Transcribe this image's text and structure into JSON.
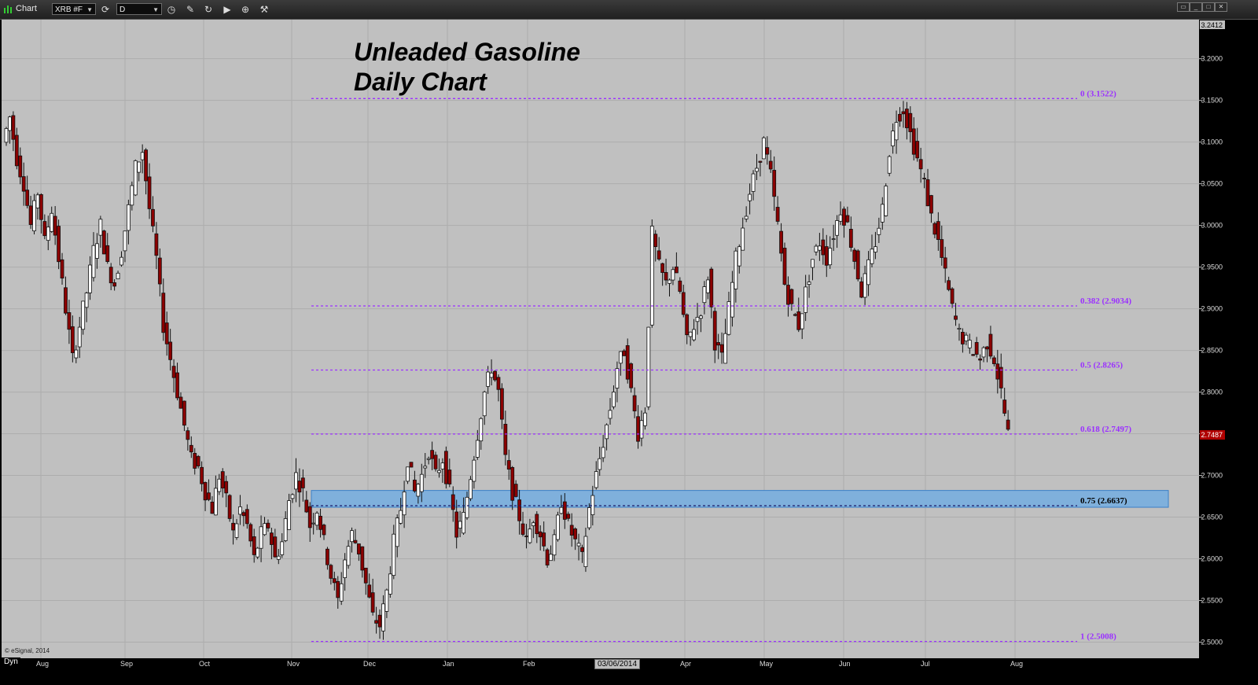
{
  "window": {
    "title": "Chart",
    "symbol": "XRB #F",
    "interval": "D"
  },
  "chart_data": {
    "type": "candlestick",
    "title": "Unleaded Gasoline",
    "subtitle": "Daily Chart",
    "ylim": [
      2.475,
      3.2412
    ],
    "y_ticks": [
      "2.5000",
      "2.5500",
      "2.6000",
      "2.6500",
      "2.7000",
      "2.7500",
      "2.8000",
      "2.8500",
      "2.9000",
      "2.9500",
      "3.0000",
      "3.0500",
      "3.1000",
      "3.1500",
      "3.2000"
    ],
    "top_axis_value": "3.2412",
    "last_price": "2.7487",
    "x_labels": [
      "Aug",
      "Sep",
      "Oct",
      "Nov",
      "Dec",
      "Jan",
      "Feb",
      "Apr",
      "May",
      "Jun",
      "Jul",
      "Aug"
    ],
    "date_marker": "03/06/2014",
    "fib_levels": [
      {
        "label": "0 (3.1522)",
        "value": 3.1522
      },
      {
        "label": "0.382 (2.9034)",
        "value": 2.9034
      },
      {
        "label": "0.5 (2.8265)",
        "value": 2.8265
      },
      {
        "label": "0.618 (2.7497)",
        "value": 2.7497
      },
      {
        "label": "0.75 (2.6637)",
        "value": 2.6637
      },
      {
        "label": "1 (2.5008)",
        "value": 2.5008
      }
    ],
    "support_zone": {
      "low": 2.6637,
      "high": 2.682
    },
    "price_path": [
      3.1,
      3.13,
      3.08,
      3.05,
      3.0,
      3.04,
      2.98,
      3.02,
      2.96,
      2.9,
      2.84,
      2.88,
      2.92,
      2.97,
      3.0,
      2.95,
      2.93,
      2.97,
      3.02,
      3.07,
      3.09,
      3.02,
      2.96,
      2.88,
      2.84,
      2.8,
      2.76,
      2.72,
      2.71,
      2.68,
      2.66,
      2.7,
      2.67,
      2.63,
      2.66,
      2.64,
      2.6,
      2.63,
      2.64,
      2.6,
      2.62,
      2.67,
      2.7,
      2.68,
      2.64,
      2.66,
      2.62,
      2.58,
      2.55,
      2.6,
      2.63,
      2.61,
      2.57,
      2.53,
      2.52,
      2.56,
      2.62,
      2.66,
      2.72,
      2.68,
      2.7,
      2.73,
      2.7,
      2.72,
      2.68,
      2.63,
      2.65,
      2.7,
      2.75,
      2.8,
      2.83,
      2.8,
      2.72,
      2.68,
      2.65,
      2.62,
      2.65,
      2.63,
      2.6,
      2.62,
      2.67,
      2.64,
      2.62,
      2.6,
      2.66,
      2.7,
      2.74,
      2.78,
      2.83,
      2.85,
      2.8,
      2.75,
      2.78,
      2.99,
      2.95,
      2.93,
      2.95,
      2.92,
      2.86,
      2.88,
      2.9,
      2.94,
      2.86,
      2.84,
      2.9,
      2.96,
      3.0,
      3.04,
      3.07,
      3.1,
      3.06,
      3.0,
      2.93,
      2.9,
      2.88,
      2.92,
      2.96,
      2.98,
      2.96,
      2.99,
      3.02,
      3.0,
      2.96,
      2.92,
      2.95,
      2.98,
      3.02,
      3.09,
      3.13,
      3.14,
      3.11,
      3.08,
      3.05,
      3.01,
      2.98,
      2.94,
      2.9,
      2.87,
      2.86,
      2.85,
      2.84,
      2.86,
      2.84,
      2.8,
      2.75
    ]
  }
}
